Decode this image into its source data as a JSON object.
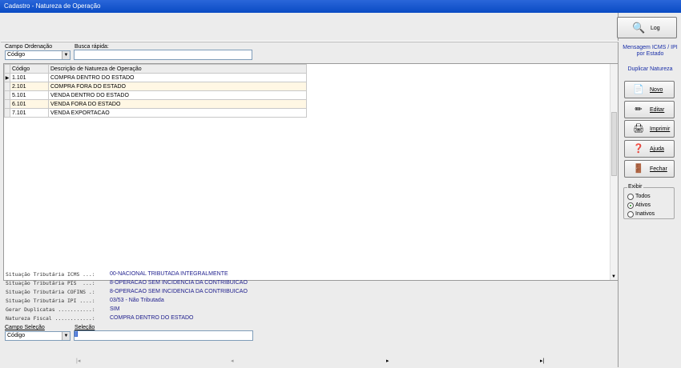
{
  "window": {
    "title": "Cadastro - Natureza de Operação"
  },
  "toolbar": {
    "log_label": "Log"
  },
  "filters": {
    "order_label": "Campo Ordenação",
    "order_value": "Código",
    "search_label": "Busca rápida:",
    "search_value": ""
  },
  "grid": {
    "columns": [
      "Código",
      "Descrição de Natureza de Operação"
    ],
    "rows": [
      {
        "codigo": "1.101",
        "descricao": "COMPRA DENTRO DO ESTADO"
      },
      {
        "codigo": "2.101",
        "descricao": "COMPRA FORA DO ESTADO"
      },
      {
        "codigo": "5.101",
        "descricao": "VENDA DENTRO DO ESTADO"
      },
      {
        "codigo": "6.101",
        "descricao": "VENDA FORA DO ESTADO"
      },
      {
        "codigo": "7.101",
        "descricao": "VENDA EXPORTACAO"
      }
    ]
  },
  "details": [
    {
      "key": "Situação Tributária ICMS ...:",
      "value": "00-NACIONAL TRIBUTADA INTEGRALMENTE"
    },
    {
      "key": "Situação Tributária PIS  ...:",
      "value": "8-OPERACAO SEM INCIDENCIA DA CONTRIBUICAO"
    },
    {
      "key": "Situação Tributária COFINS .:",
      "value": "8-OPERACAO SEM INCIDENCIA DA CONTRIBUICAO"
    },
    {
      "key": "Situação Tributária IPI ....:",
      "value": "03/53 - Não Tributada"
    },
    {
      "key": "Gerar Duplicatas ...........:",
      "value": "SIM"
    },
    {
      "key": "Natureza Fiscal ............:",
      "value": "COMPRA DENTRO DO ESTADO"
    }
  ],
  "selection": {
    "field_label": "Campo Seleção",
    "field_value": "Código",
    "sel_label": "Seleção",
    "sel_value": "|"
  },
  "nav": {
    "first": "|◂",
    "prev": "◂",
    "next": "▸",
    "last": "▸|"
  },
  "sidebar": {
    "msg_link": "Mensagem ICMS / IPI por Estado",
    "dup_link": "Duplicar Natureza",
    "buttons": {
      "novo": "Novo",
      "editar": "Editar",
      "imprimir": "Imprimir",
      "ajuda": "Ajuda",
      "fechar": "Fechar"
    },
    "exibir": {
      "legend": "Exibir",
      "options": [
        "Todos",
        "Ativos",
        "Inativos"
      ],
      "selected": "Ativos"
    }
  }
}
